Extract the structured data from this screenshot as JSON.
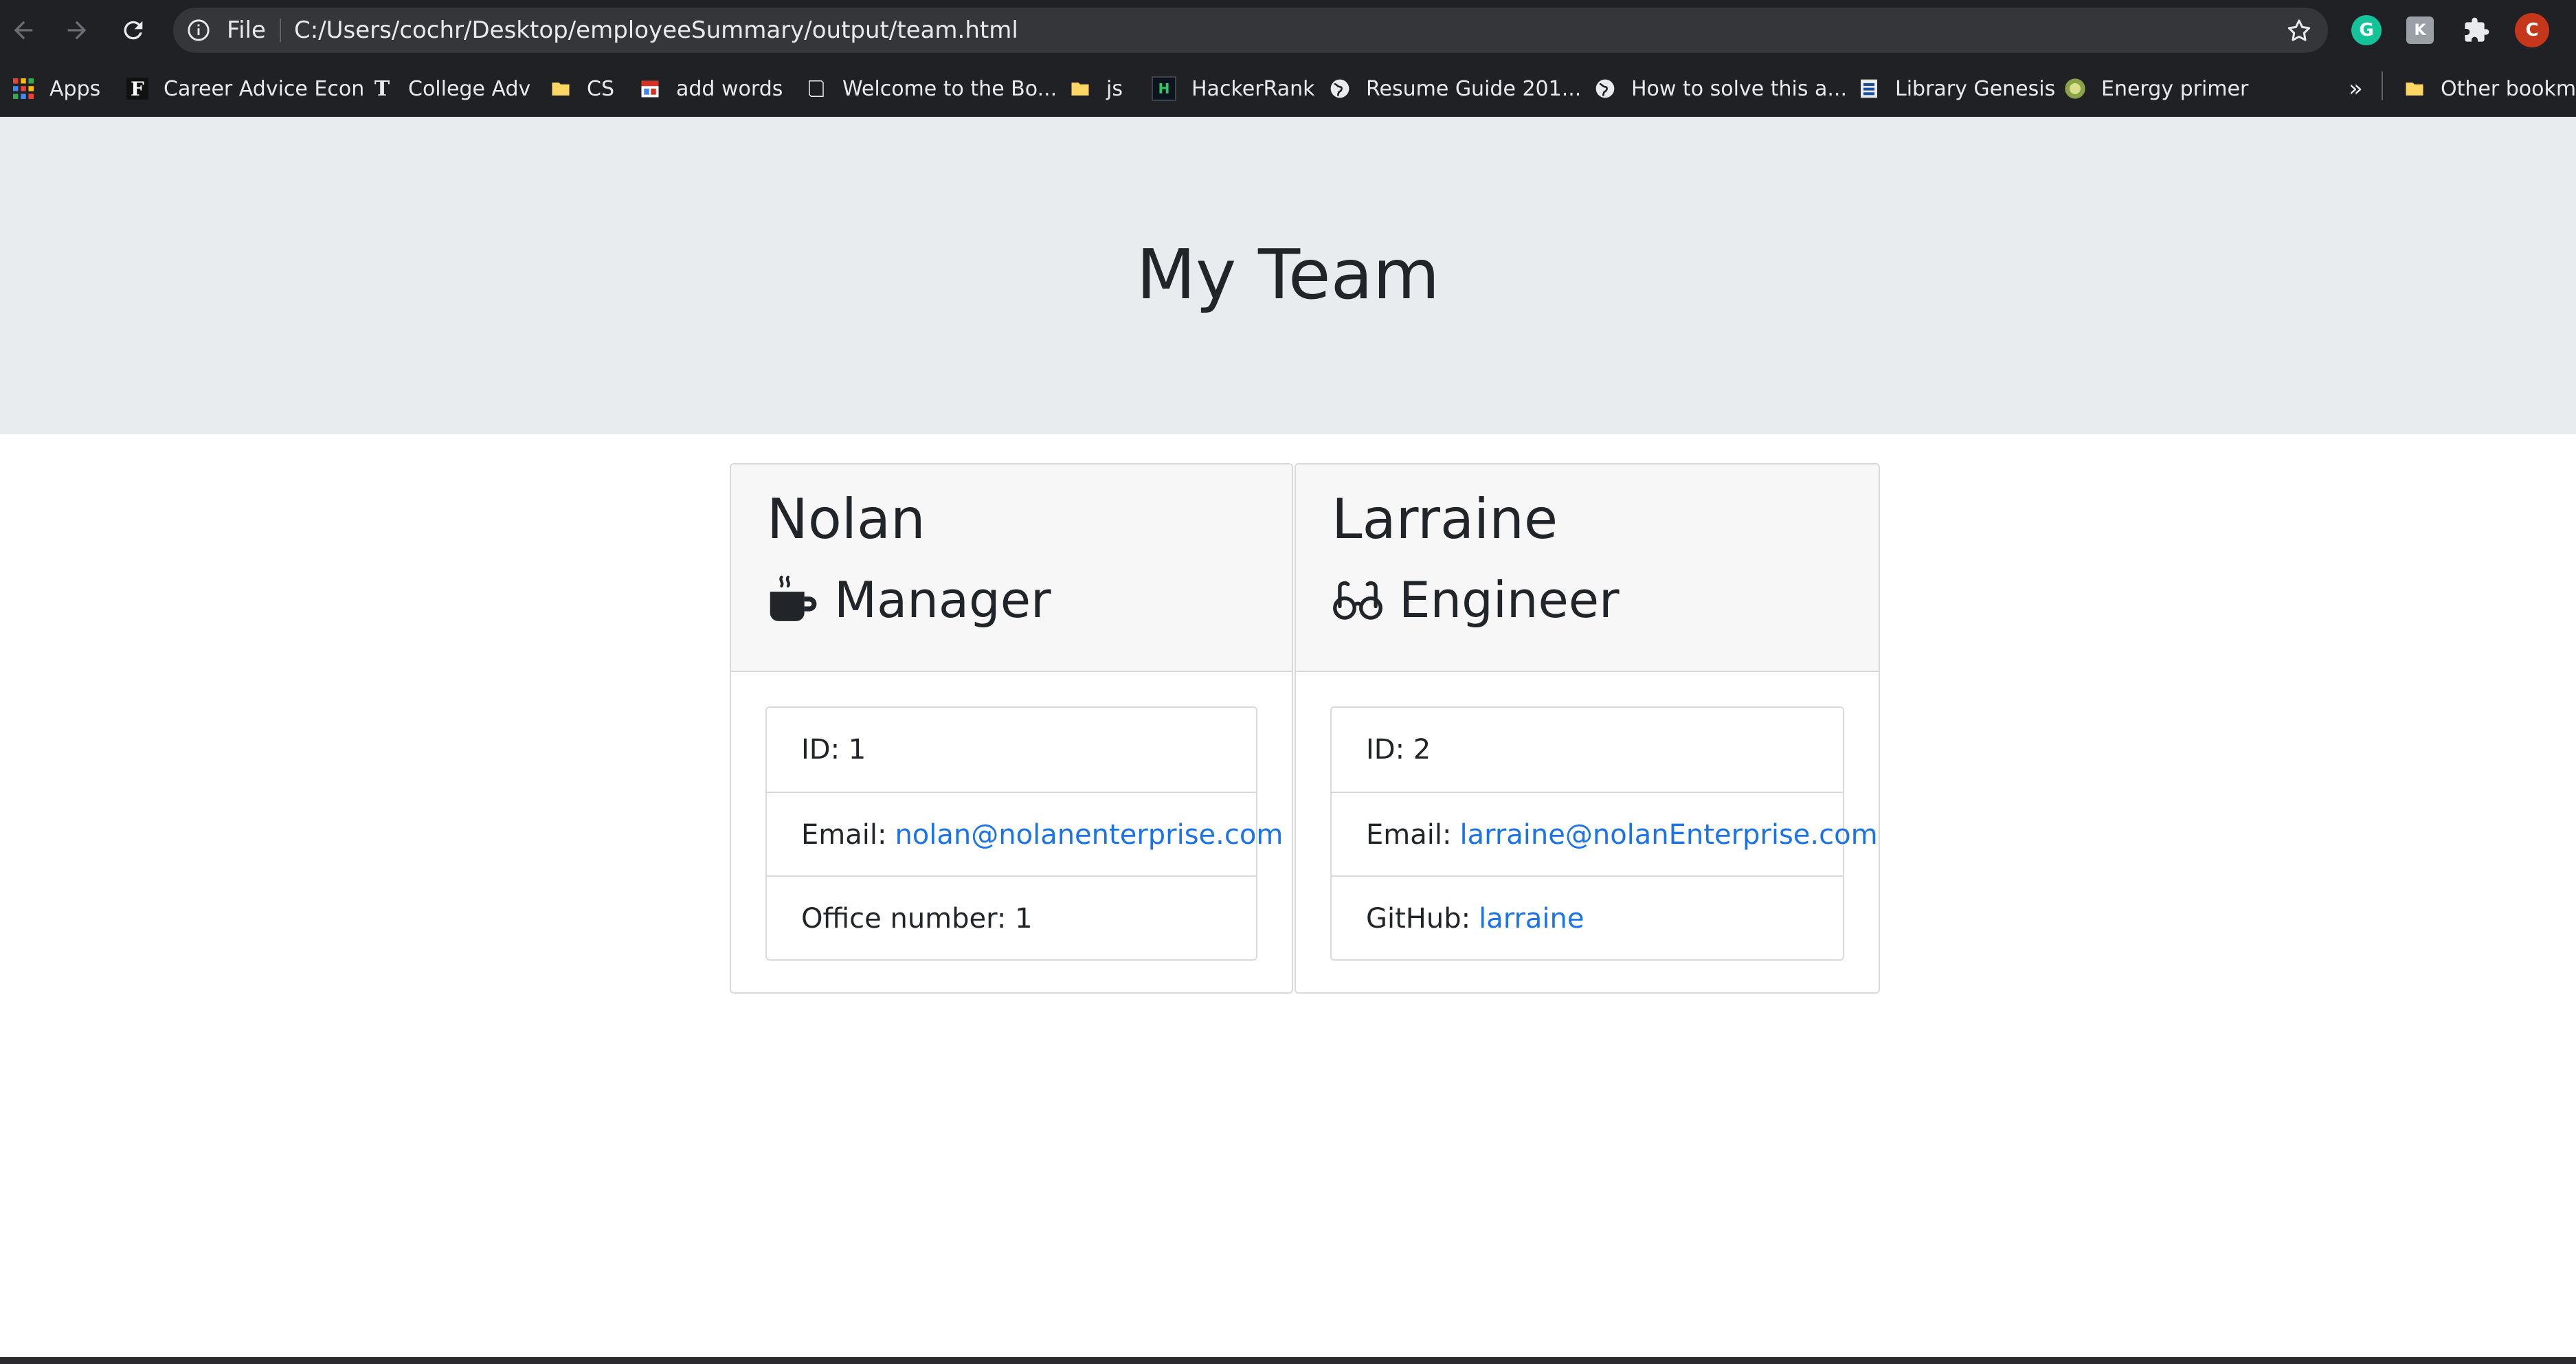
{
  "browser": {
    "scheme_label": "File",
    "url": "C:/Users/cochr/Desktop/employeeSummary/output/team.html",
    "profile_initial": "C",
    "bookmarks": [
      {
        "label": "Apps",
        "icon": "apps-grid-icon"
      },
      {
        "label": "Career Advice Econ",
        "icon": "f-logo-icon"
      },
      {
        "label": "College Adv",
        "icon": "nyt-logo-icon"
      },
      {
        "label": "CS",
        "icon": "folder-icon"
      },
      {
        "label": "add words",
        "icon": "calendar-icon"
      },
      {
        "label": "Welcome to the Bo...",
        "icon": "book-icon"
      },
      {
        "label": "js",
        "icon": "folder-icon"
      },
      {
        "label": "HackerRank",
        "icon": "hackerrank-icon"
      },
      {
        "label": "Resume Guide 201...",
        "icon": "globe-icon"
      },
      {
        "label": "How to solve this a...",
        "icon": "globe-icon"
      },
      {
        "label": "Library Genesis",
        "icon": "library-icon"
      },
      {
        "label": "Energy primer",
        "icon": "energy-icon"
      }
    ],
    "overflow_label": "»",
    "other_bookmarks_label": "Other bookmarks"
  },
  "page": {
    "title": "My Team"
  },
  "employees": [
    {
      "name": "Nolan",
      "role": "Manager",
      "role_icon": "coffee-mug-icon",
      "id_text": "ID: 1",
      "email_prefix": "Email:",
      "email": "nolan@nolanenterprise.com",
      "extra_text": "Office number: 1"
    },
    {
      "name": "Larraine",
      "role": "Engineer",
      "role_icon": "glasses-icon",
      "id_text": "ID: 2",
      "email_prefix": "Email:",
      "email": "larraine@nolanEnterprise.com",
      "extra_prefix": "GitHub:",
      "github": "larraine"
    }
  ],
  "colors": {
    "chrome": "#202124",
    "jumbotron": "#e9ecef",
    "link": "#1a73e8",
    "text": "#212529"
  }
}
